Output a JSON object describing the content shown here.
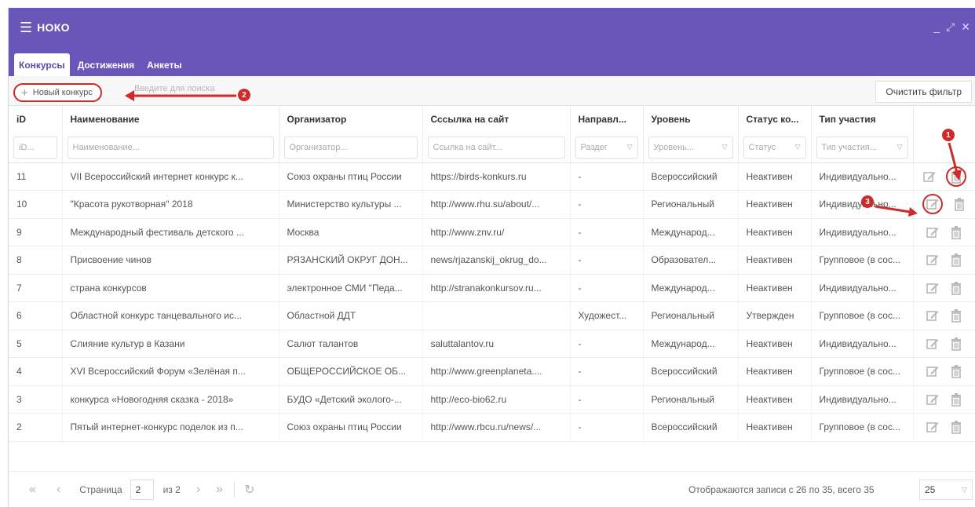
{
  "app": {
    "title": "НОКО"
  },
  "tabs": [
    {
      "label": "Конкурсы"
    },
    {
      "label": "Достижения"
    },
    {
      "label": "Анкеты"
    }
  ],
  "toolbar": {
    "new_label": "Новый конкурс",
    "search_placeholder": "Введите для поиска",
    "clear_label": "Очистить фильтр"
  },
  "columns": [
    "iD",
    "Наименование",
    "Организатор",
    "Сссылка на сайт",
    "Направл...",
    "Уровень",
    "Статус ко...",
    "Тип участия"
  ],
  "filters": [
    "iD...",
    "Наименование...",
    "Организатор...",
    "Ссылка на сайт...",
    "Раздег",
    "Уровень...",
    "Статус",
    "Тип участия..."
  ],
  "rows": [
    {
      "id": "11",
      "name": "VII Всероссийский интернет конкурс к...",
      "org": "Союз охраны птиц России",
      "url": "https://birds-konkurs.ru",
      "dir": "-",
      "level": "Всероссийский",
      "status": "Неактивен",
      "type": "Индивидуально..."
    },
    {
      "id": "10",
      "name": "\"Красота рукотворная\" 2018",
      "org": "Министерство культуры ...",
      "url": "http://www.rhu.su/about/...",
      "dir": "-",
      "level": "Региональный",
      "status": "Неактивен",
      "type": "Индивидуально..."
    },
    {
      "id": "9",
      "name": "Международный фестиваль детского ...",
      "org": "Москва",
      "url": "http://www.znv.ru/",
      "dir": "-",
      "level": "Международ...",
      "status": "Неактивен",
      "type": "Индивидуально..."
    },
    {
      "id": "8",
      "name": "Присвоение чинов",
      "org": "РЯЗАНСКИЙ ОКРУГ ДОН...",
      "url": "news/rjazanskij_okrug_do...",
      "dir": "-",
      "level": "Образовател...",
      "status": "Неактивен",
      "type": "Групповое (в сос..."
    },
    {
      "id": "7",
      "name": "страна конкурсов",
      "org": "электронное СМИ \"Педа...",
      "url": "http://stranakonkursov.ru...",
      "dir": "-",
      "level": "Международ...",
      "status": "Неактивен",
      "type": "Индивидуально..."
    },
    {
      "id": "6",
      "name": "Областной конкурс танцевального ис...",
      "org": "Областной ДДТ",
      "url": "",
      "dir": "Художест...",
      "level": "Региональный",
      "status": "Утвержден",
      "type": "Групповое (в сос..."
    },
    {
      "id": "5",
      "name": "Слияние культур в Казани",
      "org": "Салют талантов",
      "url": "saluttalantov.ru",
      "dir": "-",
      "level": "Международ...",
      "status": "Неактивен",
      "type": "Индивидуально..."
    },
    {
      "id": "4",
      "name": "XVI Всероссийский Форум «Зелёная п...",
      "org": "ОБЩЕРОССИЙСКОЕ ОБ...",
      "url": "http://www.greenplaneta....",
      "dir": "-",
      "level": "Всероссийский",
      "status": "Неактивен",
      "type": "Групповое (в сос..."
    },
    {
      "id": "3",
      "name": "конкурса «Новогодняя сказка - 2018»",
      "org": "БУДО «Детский эколого-...",
      "url": "http://eco-bio62.ru",
      "dir": "-",
      "level": "Региональный",
      "status": "Неактивен",
      "type": "Индивидуально..."
    },
    {
      "id": "2",
      "name": "Пятый интернет-конкурс поделок из п...",
      "org": "Союз охраны птиц России",
      "url": "http://www.rbcu.ru/news/...",
      "dir": "-",
      "level": "Всероссийский",
      "status": "Неактивен",
      "type": "Групповое (в сос..."
    }
  ],
  "pager": {
    "page_label": "Страница",
    "page_value": "2",
    "of_label": "из 2",
    "summary": "Отображаются записи с 26 по 35, всего 35",
    "page_size": "25"
  },
  "annotations": [
    "1",
    "2",
    "3"
  ],
  "colors": {
    "header": "#6a55b8",
    "annotation": "#cf2a27"
  }
}
